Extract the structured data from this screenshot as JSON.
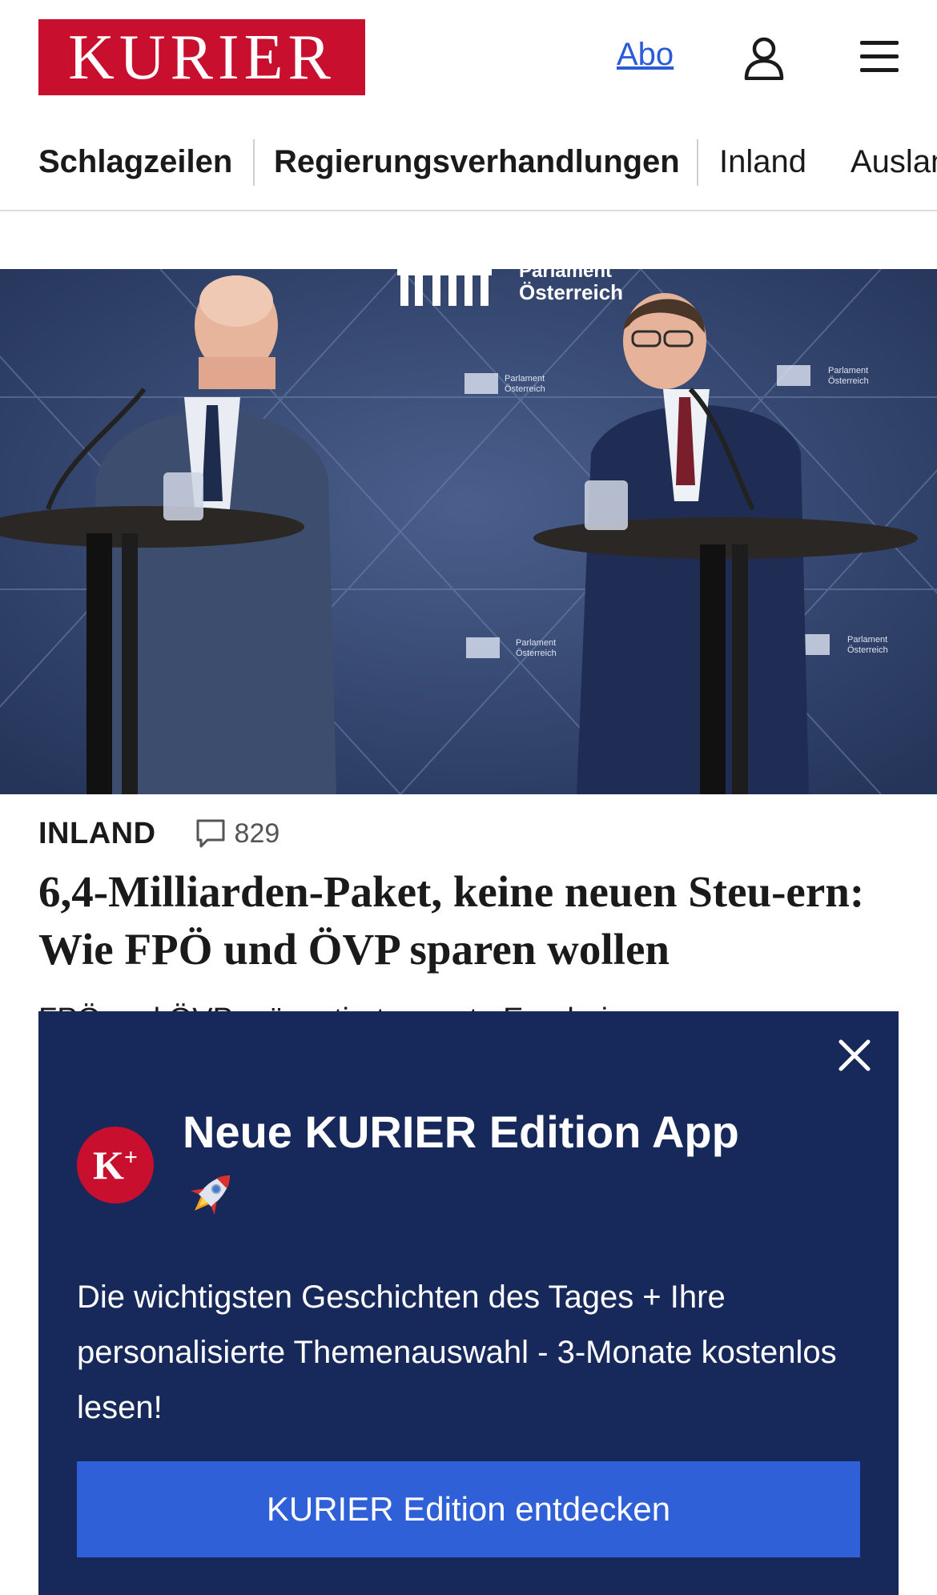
{
  "header": {
    "logo_text": "KURIER",
    "abo_label": "Abo",
    "user_icon": "user-icon",
    "menu_icon": "hamburger-menu-icon",
    "brand_color": "#c8102e",
    "link_color": "#2b5bd7"
  },
  "nav": {
    "items": [
      {
        "label": "Schlagzeilen"
      },
      {
        "label": "Regierungsverhandlungen"
      },
      {
        "label": "Inland"
      },
      {
        "label": "Ausland"
      }
    ]
  },
  "hero": {
    "backdrop_text_line1": "Parlament",
    "backdrop_text_line2": "Österreich",
    "small_logo_line1": "Parlament",
    "small_logo_line2": "Österreich"
  },
  "article": {
    "category": "INLAND",
    "comment_icon": "comment-bubble-icon",
    "comment_count": "829",
    "headline": "6,4-Milliarden-Paket, keine neuen Steu-ern: Wie FPÖ und ÖVP sparen wollen",
    "lead_teaser": "FPÖ und ÖVP präsentierten erste Ergebnisse"
  },
  "promo": {
    "close_icon": "close-icon",
    "badge_text": "K",
    "badge_sup": "+",
    "title": "Neue KURIER Edition App",
    "rocket_icon": "rocket-icon",
    "body": "Die wichtigsten Geschichten des Tages + Ihre personalisierte Themenauswahl - 3-Monate kostenlos lesen!",
    "cta_label": "KURIER Edition entdecken",
    "background_color": "#17285b",
    "cta_color": "#3060d8"
  }
}
